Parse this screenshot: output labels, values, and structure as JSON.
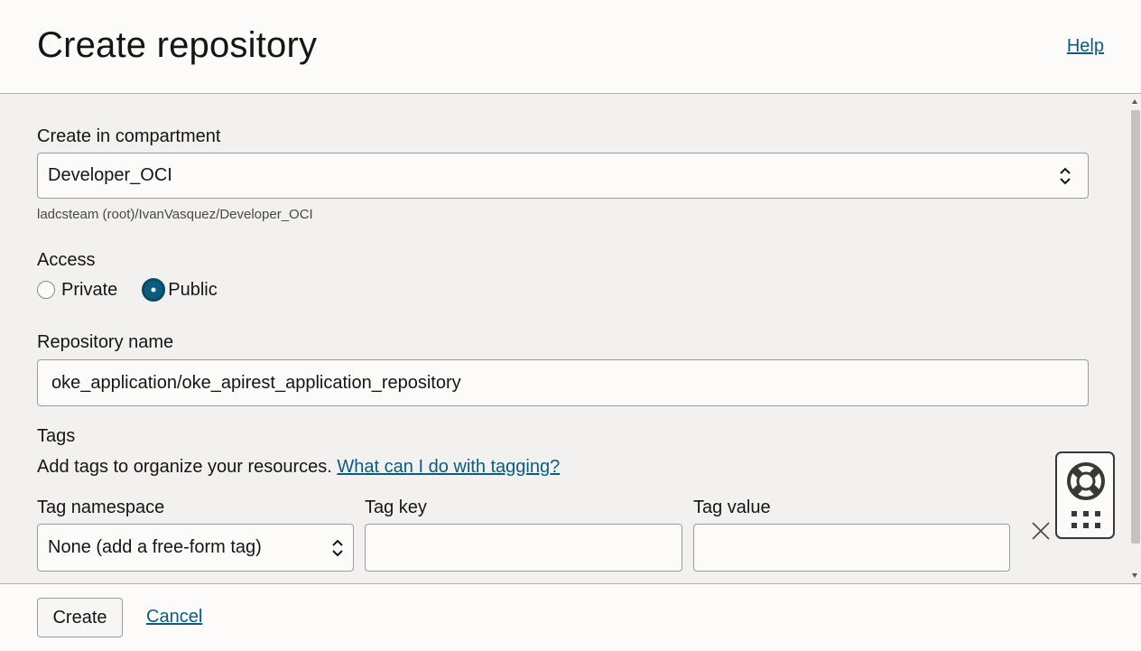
{
  "header": {
    "title": "Create repository",
    "help_label": "Help"
  },
  "compartment": {
    "label": "Create in compartment",
    "value": "Developer_OCI",
    "path": "ladcsteam (root)/IvanVasquez/Developer_OCI"
  },
  "access": {
    "label": "Access",
    "options": [
      {
        "label": "Private",
        "checked": false
      },
      {
        "label": "Public",
        "checked": true
      }
    ]
  },
  "repository_name": {
    "label": "Repository name",
    "value": "oke_application/oke_apirest_application_repository"
  },
  "tags": {
    "label": "Tags",
    "description": "Add tags to organize your resources.",
    "help_link": "What can I do with tagging?",
    "namespace_label": "Tag namespace",
    "namespace_value": "None (add a free-form tag)",
    "key_label": "Tag key",
    "key_value": "",
    "value_label": "Tag value",
    "value_value": ""
  },
  "footer": {
    "create_label": "Create",
    "cancel_label": "Cancel"
  },
  "colors": {
    "accent": "#0b5d80",
    "background": "#f2f1ef",
    "surface": "#fcfbfa"
  }
}
